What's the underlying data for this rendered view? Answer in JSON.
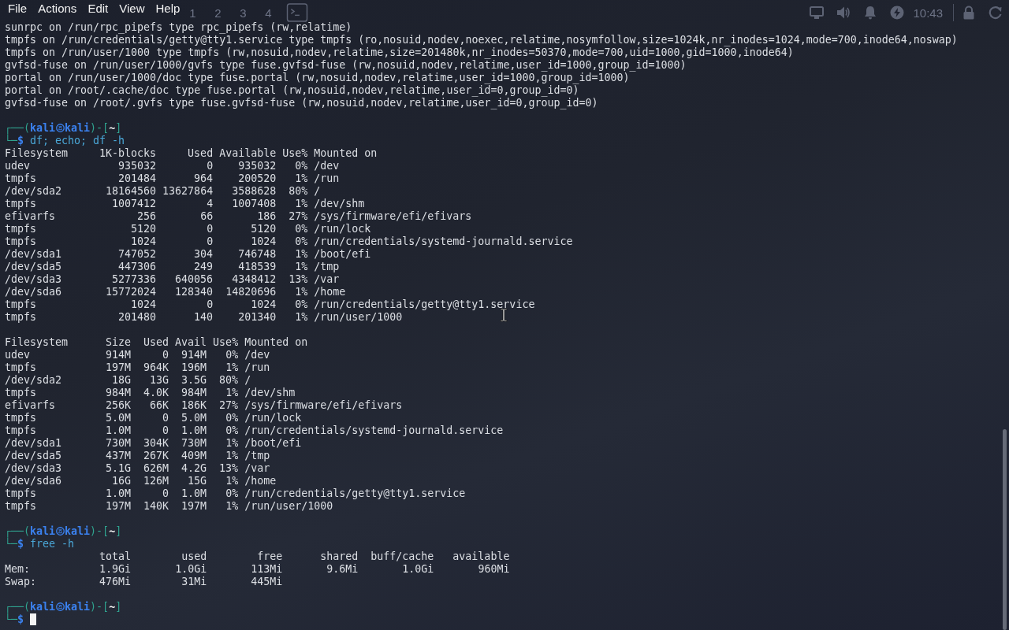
{
  "menu_bar": [
    "File",
    "Actions",
    "Edit",
    "View",
    "Help"
  ],
  "desktop_panel": {
    "workspaces": [
      {
        "label": "1"
      },
      {
        "label": "2"
      },
      {
        "label": "3"
      },
      {
        "label": "4"
      }
    ],
    "clock": "10:43"
  },
  "terminal": {
    "blocks": [
      {
        "kind": "output",
        "lines": [
          "sunrpc on /run/rpc_pipefs type rpc_pipefs (rw,relatime)",
          "tmpfs on /run/credentials/getty@tty1.service type tmpfs (ro,nosuid,nodev,noexec,relatime,nosymfollow,size=1024k,nr_inodes=1024,mode=700,inode64,noswap)",
          "tmpfs on /run/user/1000 type tmpfs (rw,nosuid,nodev,relatime,size=201480k,nr_inodes=50370,mode=700,uid=1000,gid=1000,inode64)",
          "gvfsd-fuse on /run/user/1000/gvfs type fuse.gvfsd-fuse (rw,nosuid,nodev,relatime,user_id=1000,group_id=1000)",
          "portal on /run/user/1000/doc type fuse.portal (rw,nosuid,nodev,relatime,user_id=1000,group_id=1000)",
          "portal on /root/.cache/doc type fuse.portal (rw,nosuid,nodev,relatime,user_id=0,group_id=0)",
          "gvfsd-fuse on /root/.gvfs type fuse.gvfsd-fuse (rw,nosuid,nodev,relatime,user_id=0,group_id=0)"
        ]
      },
      {
        "kind": "prompt",
        "frame_top": "┌──(",
        "user": "kali",
        "host": "kali",
        "separator": ")-[",
        "dir": "~",
        "dir_close": "]",
        "frame_bottom": "└─",
        "symbol": "$",
        "command": "df; echo; df -h",
        "cursor": false
      },
      {
        "kind": "df",
        "columns": [
          "Filesystem",
          "1K-blocks",
          "Used",
          "Available",
          "Use%",
          "Mounted on"
        ],
        "rows": [
          [
            "udev",
            "935032",
            "0",
            "935032",
            "0%",
            "/dev"
          ],
          [
            "tmpfs",
            "201484",
            "964",
            "200520",
            "1%",
            "/run"
          ],
          [
            "/dev/sda2",
            "18164560",
            "13627864",
            "3588628",
            "80%",
            "/"
          ],
          [
            "tmpfs",
            "1007412",
            "4",
            "1007408",
            "1%",
            "/dev/shm"
          ],
          [
            "efivarfs",
            "256",
            "66",
            "186",
            "27%",
            "/sys/firmware/efi/efivars"
          ],
          [
            "tmpfs",
            "5120",
            "0",
            "5120",
            "0%",
            "/run/lock"
          ],
          [
            "tmpfs",
            "1024",
            "0",
            "1024",
            "0%",
            "/run/credentials/systemd-journald.service"
          ],
          [
            "/dev/sda1",
            "747052",
            "304",
            "746748",
            "1%",
            "/boot/efi"
          ],
          [
            "/dev/sda5",
            "447306",
            "249",
            "418539",
            "1%",
            "/tmp"
          ],
          [
            "/dev/sda3",
            "5277336",
            "640056",
            "4348412",
            "13%",
            "/var"
          ],
          [
            "/dev/sda6",
            "15772024",
            "128340",
            "14820696",
            "1%",
            "/home"
          ],
          [
            "tmpfs",
            "1024",
            "0",
            "1024",
            "0%",
            "/run/credentials/getty@tty1.service"
          ],
          [
            "tmpfs",
            "201480",
            "140",
            "201340",
            "1%",
            "/run/user/1000"
          ]
        ]
      },
      {
        "kind": "df_h",
        "columns": [
          "Filesystem",
          "Size",
          "Used",
          "Avail",
          "Use%",
          "Mounted on"
        ],
        "rows": [
          [
            "udev",
            "914M",
            "0",
            "914M",
            "0%",
            "/dev"
          ],
          [
            "tmpfs",
            "197M",
            "964K",
            "196M",
            "1%",
            "/run"
          ],
          [
            "/dev/sda2",
            "18G",
            "13G",
            "3.5G",
            "80%",
            "/"
          ],
          [
            "tmpfs",
            "984M",
            "4.0K",
            "984M",
            "1%",
            "/dev/shm"
          ],
          [
            "efivarfs",
            "256K",
            "66K",
            "186K",
            "27%",
            "/sys/firmware/efi/efivars"
          ],
          [
            "tmpfs",
            "5.0M",
            "0",
            "5.0M",
            "0%",
            "/run/lock"
          ],
          [
            "tmpfs",
            "1.0M",
            "0",
            "1.0M",
            "0%",
            "/run/credentials/systemd-journald.service"
          ],
          [
            "/dev/sda1",
            "730M",
            "304K",
            "730M",
            "1%",
            "/boot/efi"
          ],
          [
            "/dev/sda5",
            "437M",
            "267K",
            "409M",
            "1%",
            "/tmp"
          ],
          [
            "/dev/sda3",
            "5.1G",
            "626M",
            "4.2G",
            "13%",
            "/var"
          ],
          [
            "/dev/sda6",
            "16G",
            "126M",
            "15G",
            "1%",
            "/home"
          ],
          [
            "tmpfs",
            "1.0M",
            "0",
            "1.0M",
            "0%",
            "/run/credentials/getty@tty1.service"
          ],
          [
            "tmpfs",
            "197M",
            "140K",
            "197M",
            "1%",
            "/run/user/1000"
          ]
        ]
      },
      {
        "kind": "prompt",
        "frame_top": "┌──(",
        "user": "kali",
        "host": "kali",
        "separator": ")-[",
        "dir": "~",
        "dir_close": "]",
        "frame_bottom": "└─",
        "symbol": "$",
        "command": "free -h",
        "cursor": false
      },
      {
        "kind": "free",
        "columns": [
          "",
          "total",
          "used",
          "free",
          "shared",
          "buff/cache",
          "available"
        ],
        "rows": [
          [
            "Mem:",
            "1.9Gi",
            "1.0Gi",
            "113Mi",
            "9.6Mi",
            "1.0Gi",
            "960Mi"
          ],
          [
            "Swap:",
            "476Mi",
            "31Mi",
            "445Mi"
          ]
        ]
      },
      {
        "kind": "prompt",
        "frame_top": "┌──(",
        "user": "kali",
        "host": "kali",
        "separator": ")-[",
        "dir": "~",
        "dir_close": "]",
        "frame_bottom": "└─",
        "symbol": "$",
        "cursor": true
      }
    ]
  }
}
